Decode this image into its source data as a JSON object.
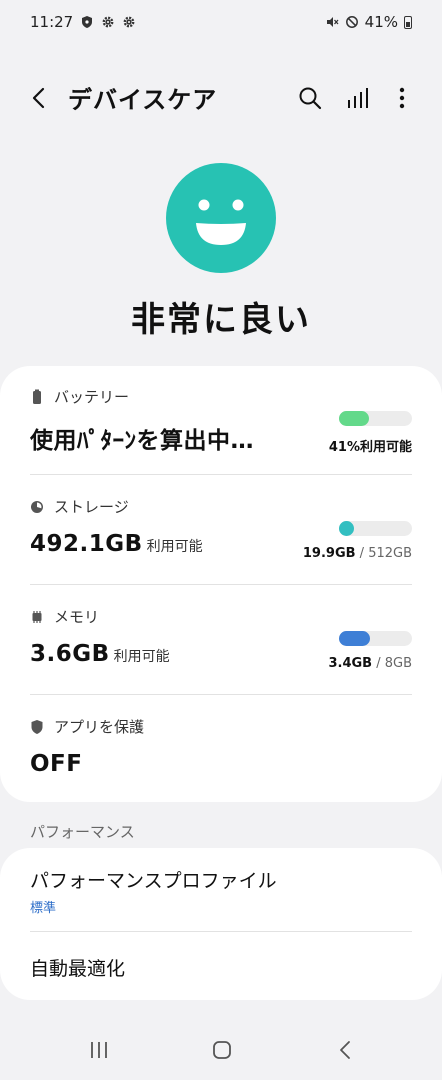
{
  "status_bar": {
    "time": "11:27",
    "battery_percent": "41%",
    "left_icons": [
      "shield-icon",
      "gear-icon",
      "gear-icon"
    ],
    "right_icons": [
      "mute-icon",
      "no-signal-icon",
      "battery-icon"
    ]
  },
  "header": {
    "title": "デバイスケア",
    "icons": [
      "back-icon",
      "search-icon",
      "signal-bars-icon",
      "more-icon"
    ]
  },
  "overview": {
    "status": "非常に良い",
    "face_color": "#27c2b3"
  },
  "items": {
    "battery": {
      "label": "バッテリー",
      "value": "使用ﾊﾟﾀｰﾝを算出中…",
      "usage_fraction": 0.41,
      "bar_color": "#63d98a",
      "caption": "41%利用可能"
    },
    "storage": {
      "label": "ストレージ",
      "value": "492.1GB",
      "value_suffix": "利用可能",
      "usage_fraction": 0.04,
      "bar_color": "#33bfc1",
      "caption_used": "19.9GB",
      "caption_total": " / 512GB"
    },
    "memory": {
      "label": "メモリ",
      "value": "3.6GB",
      "value_suffix": "利用可能",
      "usage_fraction": 0.42,
      "bar_color": "#3e7fd6",
      "caption_used": "3.4GB",
      "caption_total": " / 8GB"
    },
    "app_protection": {
      "label": "アプリを保護",
      "value": "OFF"
    }
  },
  "performance": {
    "section_title": "パフォーマンス",
    "profile_title": "パフォーマンスプロファイル",
    "profile_value": "標準",
    "auto_optimize": "自動最適化"
  },
  "nav": {
    "icons": [
      "recents-icon",
      "home-icon",
      "back-icon"
    ]
  }
}
